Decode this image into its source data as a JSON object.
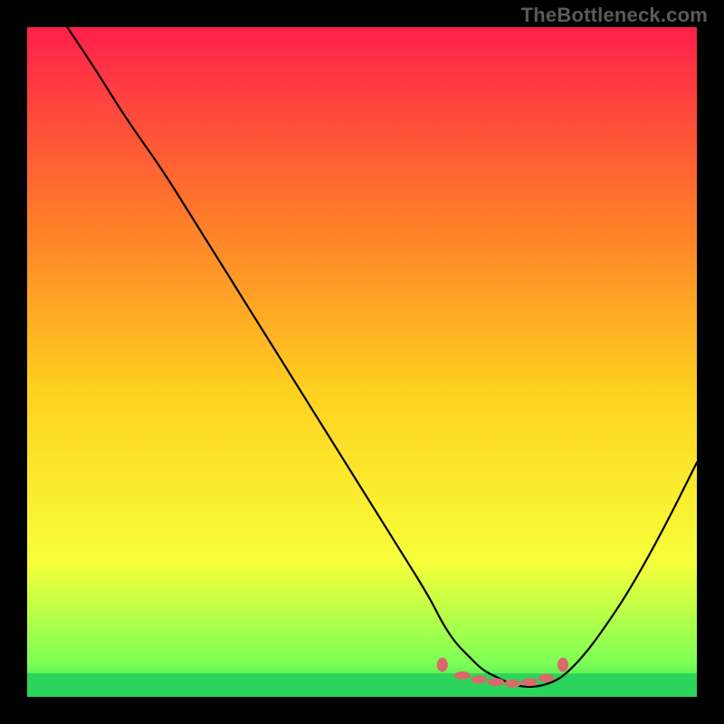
{
  "watermark": "TheBottleneck.com",
  "chart_data": {
    "type": "line",
    "title": "",
    "xlabel": "",
    "ylabel": "",
    "xlim": [
      0,
      100
    ],
    "ylim": [
      0,
      100
    ],
    "grid": false,
    "legend_position": "none",
    "series": [
      {
        "name": "bottleneck-curve",
        "color": "#000000",
        "x": [
          6,
          10,
          15,
          20,
          25,
          30,
          35,
          40,
          45,
          50,
          55,
          60,
          62,
          64,
          66,
          68,
          70,
          72,
          74,
          76,
          78,
          80,
          83,
          86,
          90,
          95,
          100
        ],
        "y": [
          100,
          94,
          86,
          79,
          71,
          63,
          55,
          47,
          39,
          31,
          23,
          15,
          11,
          8,
          6,
          4,
          3,
          2,
          1.5,
          1.5,
          2,
          3,
          6,
          10,
          16,
          25,
          35
        ]
      },
      {
        "name": "green-band-top",
        "color": "#2bd45a",
        "x": [
          0,
          100
        ],
        "y": [
          3.5,
          3.5
        ]
      },
      {
        "name": "green-band-bottom",
        "color": "#2bd45a",
        "x": [
          0,
          100
        ],
        "y": [
          0,
          0
        ]
      }
    ],
    "markers": {
      "name": "highlight-dots",
      "color": "#d86a6a",
      "points": [
        {
          "x": 62,
          "y": 4.8
        },
        {
          "x": 65,
          "y": 3.2
        },
        {
          "x": 67.5,
          "y": 2.6
        },
        {
          "x": 70,
          "y": 2.2
        },
        {
          "x": 72.5,
          "y": 2.0
        },
        {
          "x": 75,
          "y": 2.2
        },
        {
          "x": 77.5,
          "y": 2.8
        },
        {
          "x": 80,
          "y": 4.8
        }
      ]
    },
    "background_gradient": {
      "top": "#ff1f4b",
      "upper_mid": "#ff7a2a",
      "mid": "#ffd21f",
      "lower_mid": "#f6ff3a",
      "band": "#7dff56",
      "bottom": "#2bd45a"
    }
  }
}
